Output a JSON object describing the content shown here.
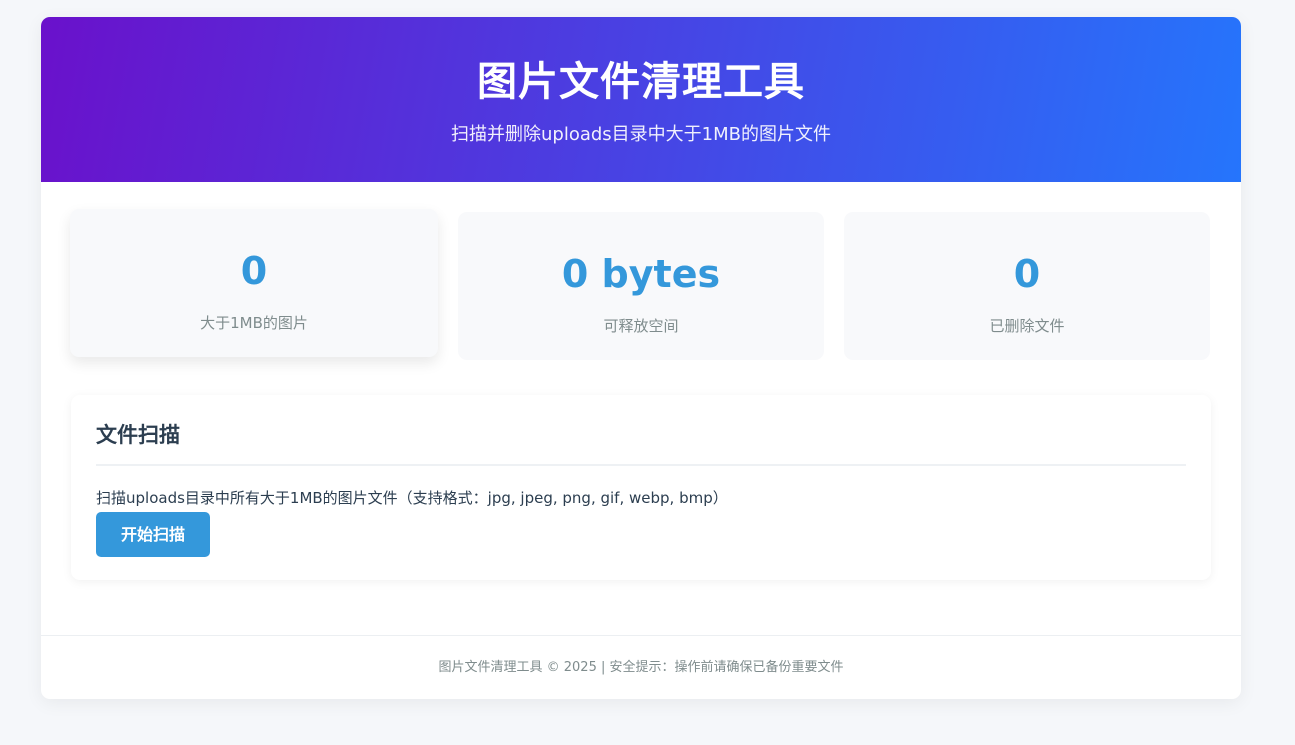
{
  "header": {
    "title": "图片文件清理工具",
    "subtitle": "扫描并删除uploads目录中大于1MB的图片文件"
  },
  "stats": [
    {
      "value": "0",
      "label": "大于1MB的图片"
    },
    {
      "value": "0 bytes",
      "label": "可释放空间"
    },
    {
      "value": "0",
      "label": "已删除文件"
    }
  ],
  "scan": {
    "title": "文件扫描",
    "description": "扫描uploads目录中所有大于1MB的图片文件（支持格式：jpg, jpeg, png, gif, webp, bmp）",
    "button_label": "开始扫描"
  },
  "footer": {
    "text": "图片文件清理工具 © 2025 | 安全提示：操作前请确保已备份重要文件"
  },
  "colors": {
    "header_gradient_start": "#6a11cb",
    "header_gradient_end": "#2575fc",
    "accent": "#3498db"
  }
}
